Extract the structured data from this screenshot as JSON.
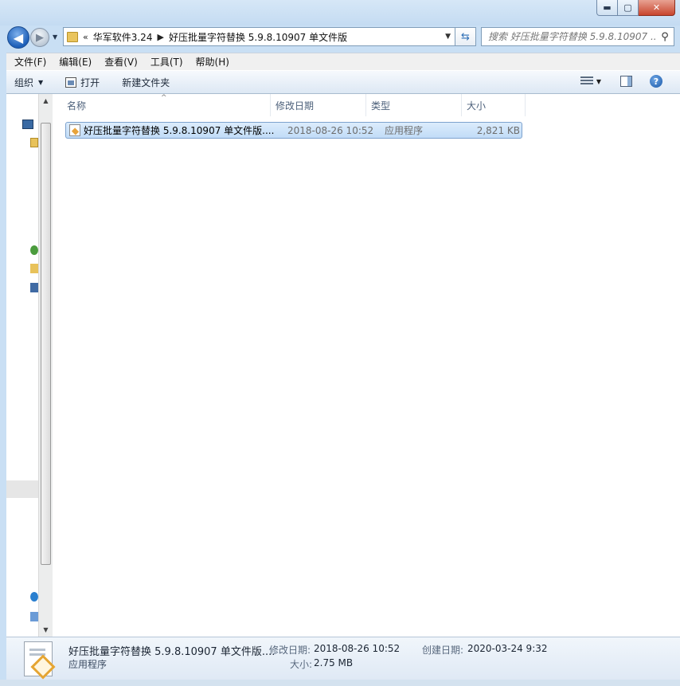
{
  "window": {
    "controls": {
      "minimize": "▬",
      "maximize": "▢",
      "close": "✕"
    }
  },
  "nav": {
    "back_glyph": "◀",
    "forward_glyph": "▶",
    "breadcrumb_overflow": "«",
    "breadcrumbs": [
      "华军软件3.24",
      "好压批量字符替换 5.9.8.10907 单文件版"
    ],
    "search_placeholder": "搜索 好压批量字符替换 5.9.8.10907 ..."
  },
  "menu": [
    "文件(F)",
    "编辑(E)",
    "查看(V)",
    "工具(T)",
    "帮助(H)"
  ],
  "toolbar": {
    "organize": "组织",
    "open": "打开",
    "new_folder": "新建文件夹"
  },
  "columns": {
    "name": "名称",
    "date": "修改日期",
    "type": "类型",
    "size": "大小"
  },
  "files": [
    {
      "name": "好压批量字符替换 5.9.8.10907 单文件版....",
      "date": "2018-08-26 10:52",
      "type": "应用程序",
      "size": "2,821 KB",
      "selected": true
    }
  ],
  "details": {
    "name": "好压批量字符替换 5.9.8.10907 单文件版....",
    "type": "应用程序",
    "modified_label": "修改日期:",
    "modified_value": "2018-08-26 10:52",
    "created_label": "创建日期:",
    "created_value": "2020-03-24 9:32",
    "size_label": "大小:",
    "size_value": "2.75 MB"
  },
  "colors": {
    "accent": "#1d5fb8",
    "selection": "#c1dcf7",
    "selection_border": "#7da2ce"
  }
}
